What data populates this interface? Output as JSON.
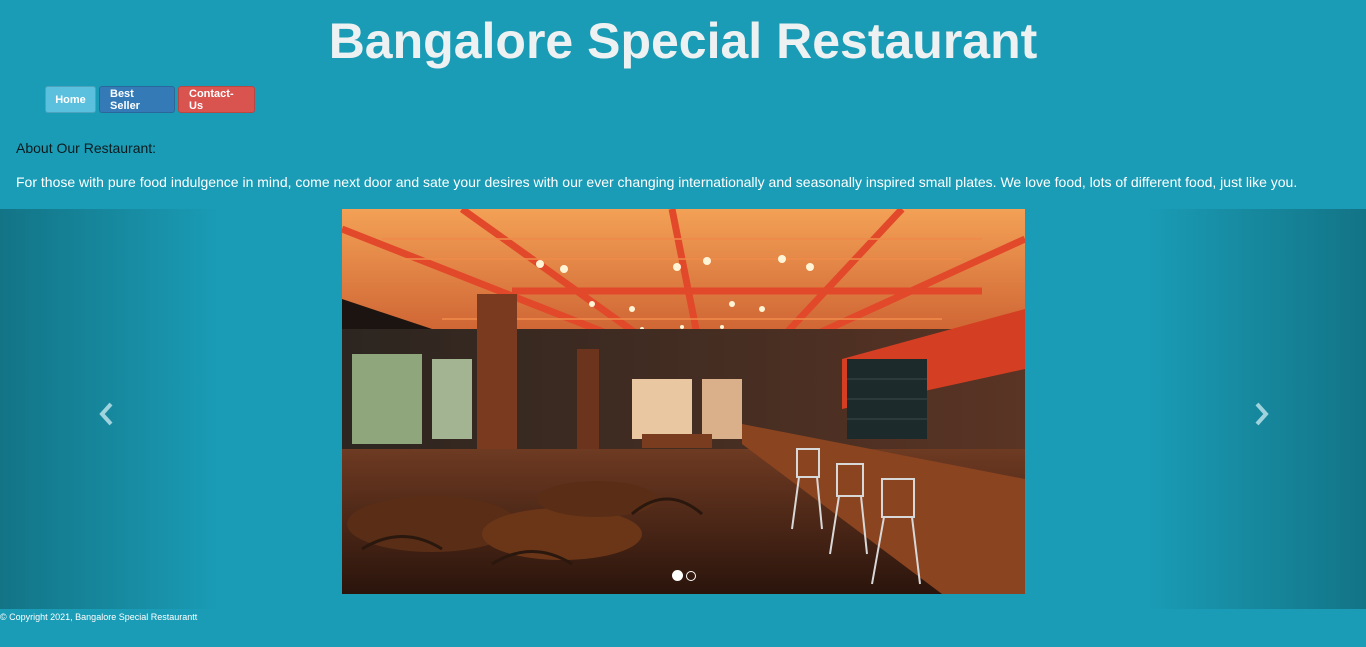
{
  "header": {
    "title": "Bangalore Special Restaurant"
  },
  "nav": {
    "home": "Home",
    "best_seller": "Best Seller",
    "contact": "Contact-Us"
  },
  "about": {
    "heading": "About Our Restaurant:",
    "text": "For those with pure food indulgence in mind, come next door and sate your desires with our ever changing internationally and seasonally inspired small plates. We love food, lots of different food, just like you."
  },
  "carousel": {
    "prev_icon": "chevron-left-icon",
    "next_icon": "chevron-right-icon",
    "slide_count": 2,
    "active_slide": 1
  },
  "footer": {
    "copyright": "© Copyright 2021, Bangalore Special Restaurantt"
  },
  "colors": {
    "background": "#1a9cb6",
    "home_button": "#5bc0de",
    "best_seller_button": "#337ab7",
    "contact_button": "#d9534f"
  }
}
